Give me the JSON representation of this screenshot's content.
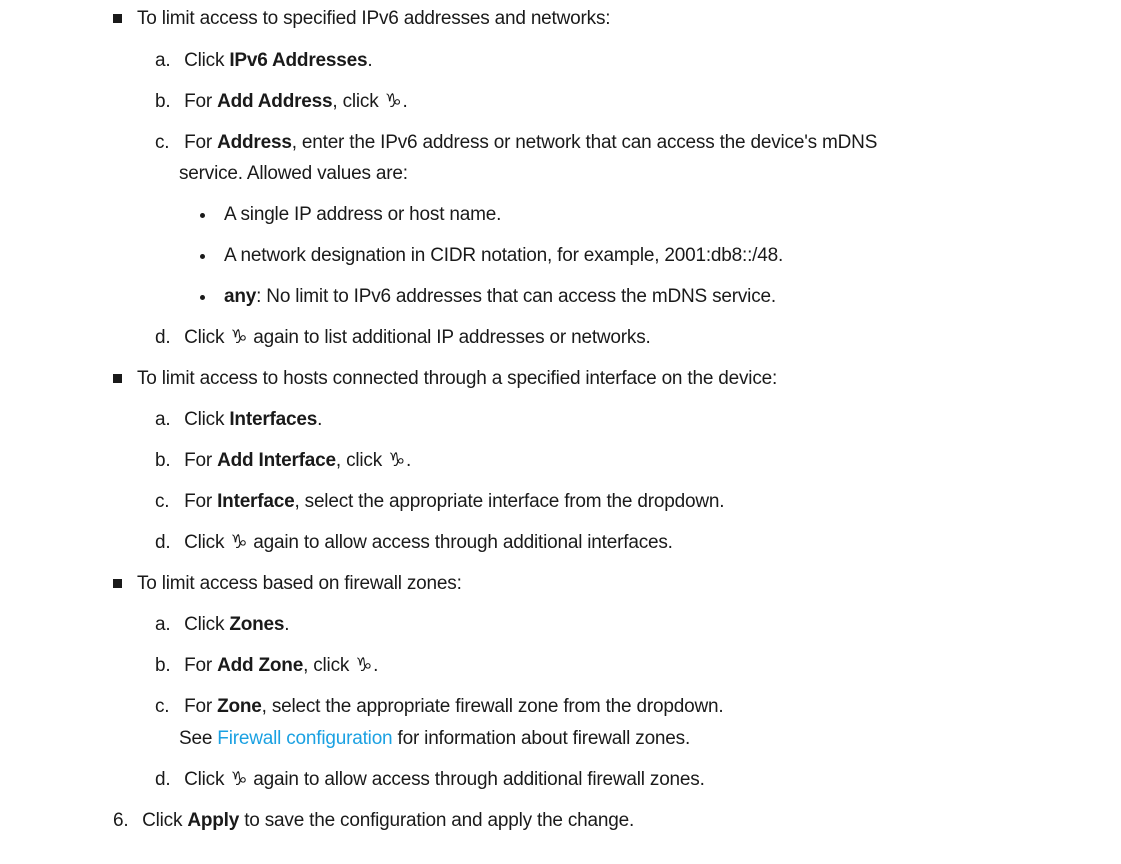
{
  "add_icon_glyph": "♑",
  "link_color": "#1ba1e2",
  "ipv6": {
    "intro": "To limit access to specified IPv6 addresses and networks:",
    "a": {
      "marker": "a.",
      "pre": "Click ",
      "bold": "IPv6 Addresses",
      "post": "."
    },
    "b": {
      "marker": "b.",
      "pre": "For ",
      "bold": "Add Address",
      "mid": ", click ",
      "post": "."
    },
    "c": {
      "marker": "c.",
      "pre": "For ",
      "bold": "Address",
      "post": ", enter the IPv6 address or network that can access the device's mDNS",
      "cont": "service. Allowed values are:"
    },
    "bullets": [
      {
        "text": "A single IP address or host name."
      },
      {
        "text": "A network designation in CIDR notation, for example, 2001:db8::/48."
      },
      {
        "bold": "any",
        "text": ": No limit to IPv6 addresses that can access the mDNS service."
      }
    ],
    "d": {
      "marker": "d.",
      "pre": "Click ",
      "post": " again to list additional IP addresses or networks."
    }
  },
  "interfaces": {
    "intro": "To limit access to hosts connected through a specified interface on the device:",
    "a": {
      "marker": "a.",
      "pre": "Click ",
      "bold": "Interfaces",
      "post": "."
    },
    "b": {
      "marker": "b.",
      "pre": "For ",
      "bold": "Add Interface",
      "mid": ", click ",
      "post": "."
    },
    "c": {
      "marker": "c.",
      "pre": "For ",
      "bold": "Interface",
      "post": ", select the appropriate interface from the dropdown."
    },
    "d": {
      "marker": "d.",
      "pre": "Click ",
      "post": " again to allow access through additional interfaces."
    }
  },
  "zones": {
    "intro": "To limit access based on firewall zones:",
    "a": {
      "marker": "a.",
      "pre": "Click ",
      "bold": "Zones",
      "post": "."
    },
    "b": {
      "marker": "b.",
      "pre": "For ",
      "bold": "Add Zone",
      "mid": ", click ",
      "post": "."
    },
    "c": {
      "marker": "c.",
      "pre": "For ",
      "bold": "Zone",
      "post": ", select the appropriate firewall zone from the dropdown."
    },
    "see": {
      "pre": "See ",
      "link": "Firewall configuration",
      "post": " for information about firewall zones."
    },
    "d": {
      "marker": "d.",
      "pre": "Click ",
      "post": " again to allow access through additional firewall zones."
    }
  },
  "step6": {
    "marker": "6.",
    "pre": "Click ",
    "bold": "Apply",
    "post": " to save the configuration and apply the change."
  }
}
